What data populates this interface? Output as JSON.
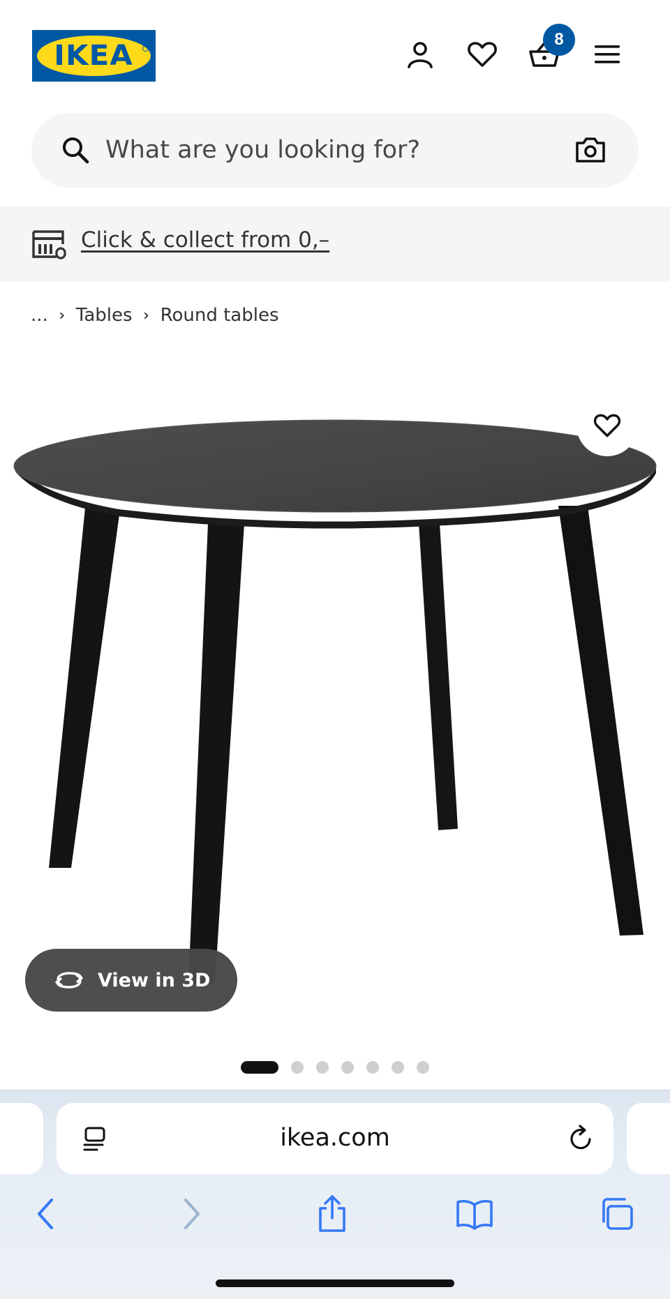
{
  "header": {
    "logo_text": "IKEA",
    "cart_count": "8",
    "icons": [
      "user-icon",
      "heart-icon",
      "basket-icon",
      "menu-icon"
    ]
  },
  "search": {
    "placeholder": "What are you looking for?"
  },
  "banner": {
    "link_text": "Click & collect from 0,–"
  },
  "breadcrumb": {
    "ellipsis": "...",
    "items": [
      "Tables",
      "Round tables"
    ]
  },
  "gallery": {
    "view_3d_label": "View in 3D",
    "total_images": 7,
    "active_index": 0
  },
  "browser": {
    "url": "ikea.com"
  },
  "colors": {
    "brand_blue": "#0058a3",
    "brand_yellow": "#ffda1a",
    "ios_blue": "#3478f6"
  }
}
